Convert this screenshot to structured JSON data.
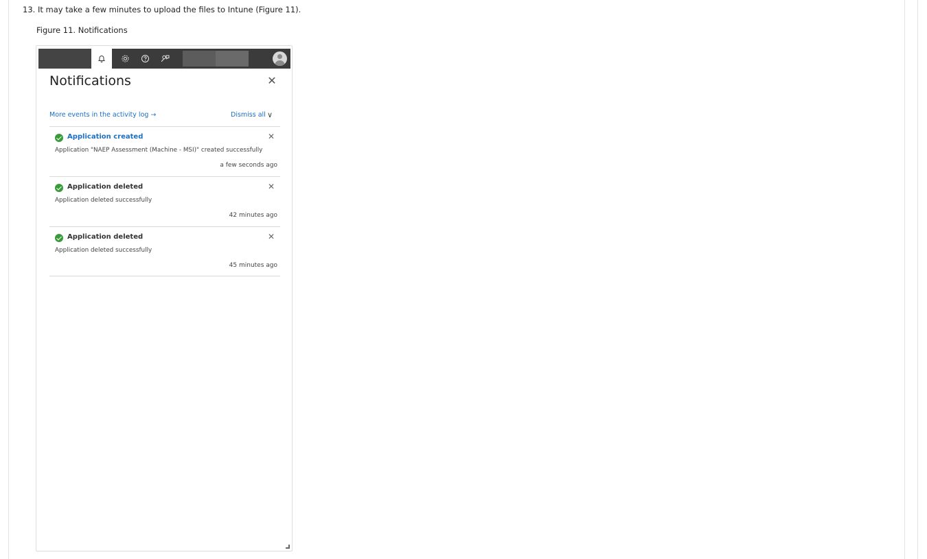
{
  "document": {
    "step_text": "13. It may take a few minutes to upload the files to Intune (Figure 11).",
    "figure_caption": "Figure 11. Notifications"
  },
  "topbar": {
    "icons": [
      "bell-icon",
      "gear-icon",
      "help-icon",
      "feedback-icon"
    ]
  },
  "panel": {
    "title": "Notifications",
    "close_glyph": "✕",
    "activity_link": "More events in the activity log →",
    "dismiss_all": "Dismiss all",
    "dismiss_chevron": "∨"
  },
  "notifications": [
    {
      "title": "Application created",
      "message": "Application \"NAEP Assessment (Machine - MSI)\" created successfully",
      "time": "a few seconds ago",
      "status": "success"
    },
    {
      "title": "Application deleted",
      "message": "Application deleted successfully",
      "time": "42 minutes ago",
      "status": "success"
    },
    {
      "title": "Application deleted",
      "message": "Application deleted successfully",
      "time": "45 minutes ago",
      "status": "success"
    }
  ],
  "colors": {
    "link": "#1b6ec2",
    "success": "#3a9b3a",
    "topbar": "#3b3b3b"
  }
}
